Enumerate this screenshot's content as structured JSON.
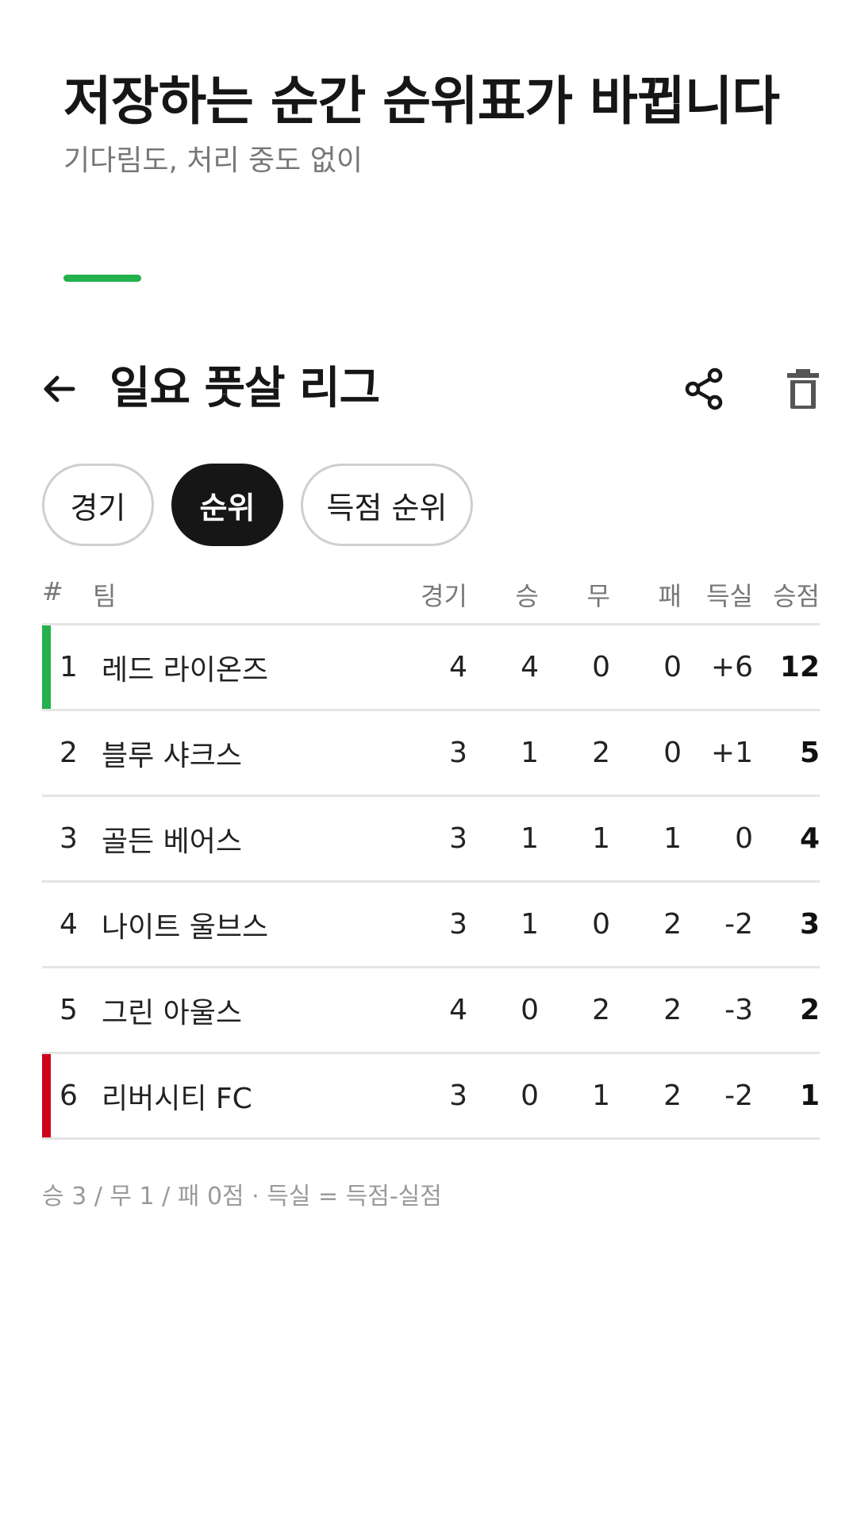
{
  "promo": {
    "title": "저장하는 순간 순위표가 바뀝니다",
    "subtitle": "기다림도, 처리 중도 없이"
  },
  "appbar": {
    "title": "일요 풋살 리그",
    "back_icon": "arrow-left-icon",
    "share_icon": "share-icon",
    "delete_icon": "trash-icon"
  },
  "tabs": [
    {
      "label": "경기",
      "active": false
    },
    {
      "label": "순위",
      "active": true
    },
    {
      "label": "득점 순위",
      "active": false
    }
  ],
  "table": {
    "headers": {
      "rank": "#",
      "team": "팀",
      "played": "경기",
      "won": "승",
      "drawn": "무",
      "lost": "패",
      "goal_diff": "득실",
      "points": "승점"
    },
    "rows": [
      {
        "rank": "1",
        "team": "레드 라이온즈",
        "played": "4",
        "won": "4",
        "drawn": "0",
        "lost": "0",
        "goal_diff": "+6",
        "points": "12",
        "marker": "#22b14c"
      },
      {
        "rank": "2",
        "team": "블루 샤크스",
        "played": "3",
        "won": "1",
        "drawn": "2",
        "lost": "0",
        "goal_diff": "+1",
        "points": "5",
        "marker": ""
      },
      {
        "rank": "3",
        "team": "골든 베어스",
        "played": "3",
        "won": "1",
        "drawn": "1",
        "lost": "1",
        "goal_diff": "0",
        "points": "4",
        "marker": ""
      },
      {
        "rank": "4",
        "team": "나이트 울브스",
        "played": "3",
        "won": "1",
        "drawn": "0",
        "lost": "2",
        "goal_diff": "-2",
        "points": "3",
        "marker": ""
      },
      {
        "rank": "5",
        "team": "그린 아울스",
        "played": "4",
        "won": "0",
        "drawn": "2",
        "lost": "2",
        "goal_diff": "-3",
        "points": "2",
        "marker": ""
      },
      {
        "rank": "6",
        "team": "리버시티 FC",
        "played": "3",
        "won": "0",
        "drawn": "1",
        "lost": "2",
        "goal_diff": "-2",
        "points": "1",
        "marker": "#d0021b"
      }
    ]
  },
  "footnote": "승 3 / 무 1 / 패 0점 · 득실 = 득점-실점",
  "colors": {
    "accent_green": "#22b14c",
    "relegation_red": "#d0021b",
    "active_tab": "#161616"
  }
}
